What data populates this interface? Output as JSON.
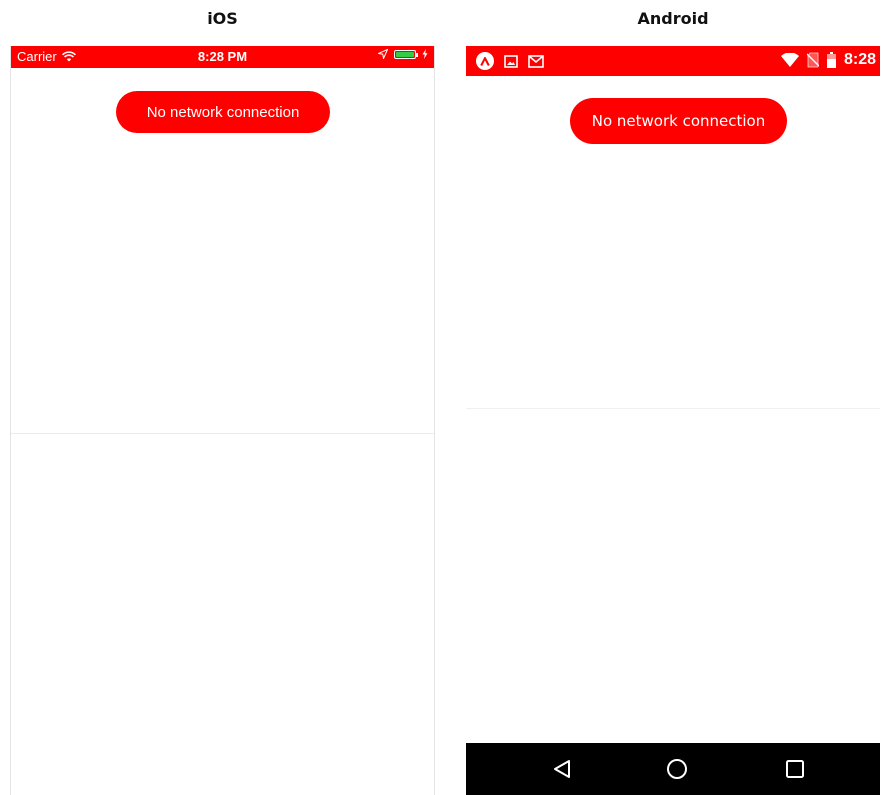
{
  "headings": {
    "ios": "iOS",
    "android": "Android"
  },
  "ios": {
    "status_bar": {
      "carrier": "Carrier",
      "time": "8:28 PM",
      "icons": [
        "wifi-icon",
        "location-arrow-icon",
        "battery-icon",
        "charging-bolt-icon"
      ]
    },
    "banner_text": "No network connection",
    "colors": {
      "accent": "#ff0000",
      "battery": "#33cc44"
    }
  },
  "android": {
    "status_bar": {
      "time": "8:28",
      "left_icons": [
        "app-logo-icon",
        "image-icon",
        "gmail-icon"
      ],
      "right_icons": [
        "wifi-icon",
        "no-sim-icon",
        "battery-icon"
      ]
    },
    "banner_text": "No network connection",
    "nav_bar": {
      "buttons": [
        "back-icon",
        "home-icon",
        "recents-icon"
      ]
    },
    "colors": {
      "accent": "#ff0000",
      "navbar": "#000000"
    }
  }
}
